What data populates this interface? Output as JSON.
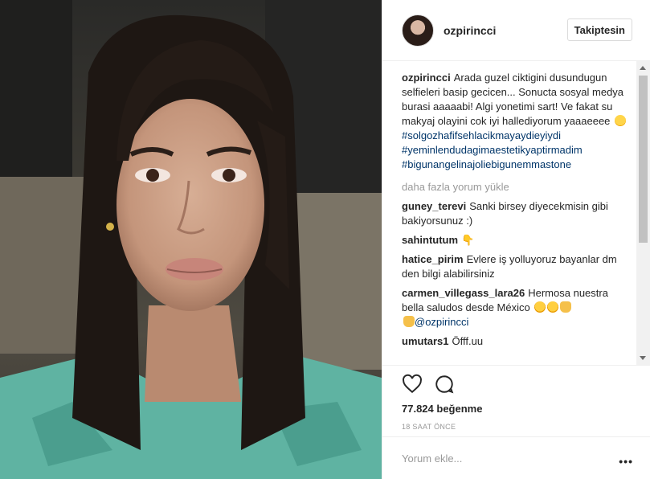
{
  "post": {
    "username": "ozpirincci",
    "follow_label": "Takiptesin",
    "caption": {
      "user": "ozpirincci",
      "text": "Arada guzel ciktigini dusundugun selfieleri basip gecicen... Sonucta sosyal medya burasi aaaaabi! Algi yonetimi sart! Ve fakat su makyaj olayini cok iyi hallediyorum yaaaeeee",
      "emoji": "wink-emoji",
      "hashtags": [
        "#solgozhafifsehlacikmayaydieyiydi",
        "#yeminlendudagimaestetikyaptirmadim",
        "#bigunangelinajoliebigunemmastone"
      ]
    },
    "load_more": "daha fazla yorum yükle",
    "comments": [
      {
        "user": "guney_terevi",
        "text": "Sanki birsey diyecekmisin gibi bakiyorsunuz :)"
      },
      {
        "user": "sahintutum",
        "text": "👇"
      },
      {
        "user": "hatice_pirim",
        "text": "Evlere iş yolluyoruz bayanlar dm den bilgi alabilirsiniz"
      },
      {
        "user": "carmen_villegass_lara26",
        "text": "Hermosa nuestra bella saludos desde México",
        "mention": "@ozpirincci"
      },
      {
        "user": "umutars1",
        "text": "Öfff.uu"
      }
    ],
    "likes": "77.824 beğenme",
    "time": "18 SAAT ÖNCE",
    "comment_placeholder": "Yorum ekle...",
    "more_options": "•••",
    "icons": [
      "heart-icon",
      "comment-icon",
      "more-options-icon"
    ],
    "colors": {
      "hashtag": "#003569",
      "muted": "#999999",
      "border": "#efefef"
    }
  }
}
